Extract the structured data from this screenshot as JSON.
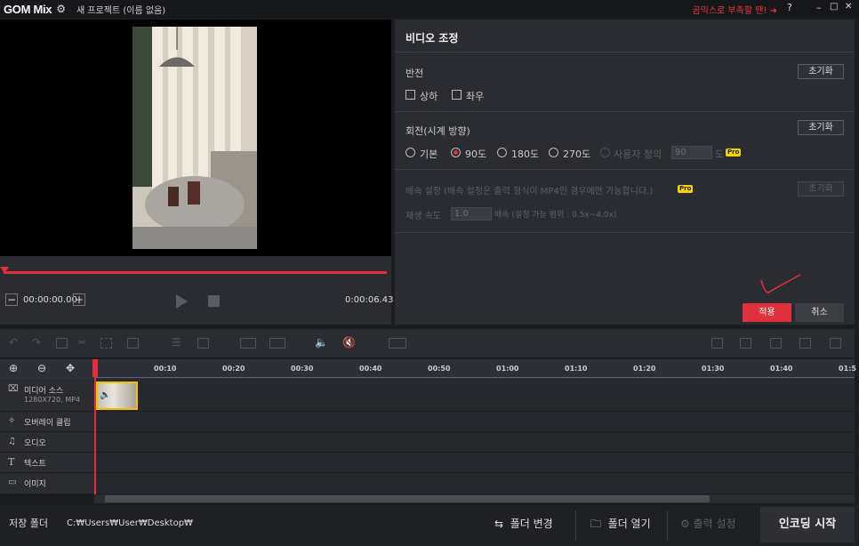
{
  "app": {
    "logo": "GOM Mix",
    "project": "새 프로젝트 (이름 없음)",
    "promo": "곰믹스로 부족할 땐!",
    "help": "?",
    "minimize": "–",
    "maximize": "□",
    "close": "✕",
    "settings_icon": "gear-icon"
  },
  "player": {
    "current_time": "00:00:00.00",
    "total_time": "0:00:06.43",
    "minus": "−",
    "plus": "+"
  },
  "panel": {
    "title": "비디오 조정",
    "flip": {
      "label": "반전",
      "reset": "초기화",
      "options": [
        "상하",
        "좌우"
      ]
    },
    "rotate": {
      "label": "회전(시계 방향)",
      "reset": "초기화",
      "options": [
        "기본",
        "90도",
        "180도",
        "270도",
        "사용자 정의"
      ],
      "selected": "90도",
      "custom_value": "90",
      "unit": "도",
      "pro": "Pro"
    },
    "speed": {
      "label": "배속 설정 (배속 설정은 출력 형식이 MP4인 경우에만 가능합니다.)",
      "reset": "초기화",
      "pro": "Pro",
      "play_speed": "재생 속도",
      "value": "1.0",
      "hint": "배속 (설정 가능 범위 : 0.5x~4.0x)"
    },
    "apply": "적용",
    "cancel": "취소"
  },
  "timeline": {
    "ticks": [
      "00:10",
      "00:20",
      "00:30",
      "00:40",
      "00:50",
      "01:00",
      "01:10",
      "01:20",
      "01:30",
      "01:40",
      "01:5"
    ],
    "tracks": [
      {
        "label": "미디어 소스",
        "sub": "1280X720, MP4",
        "icon": "media-icon"
      },
      {
        "label": "오버레이 클립",
        "icon": "overlay-icon"
      },
      {
        "label": "오디오",
        "icon": "music-icon"
      },
      {
        "label": "텍스트",
        "icon": "text-icon"
      },
      {
        "label": "이미지",
        "icon": "image-icon"
      }
    ]
  },
  "bottom": {
    "save_folder_label": "저장 폴더",
    "path": "C:₩Users₩User₩Desktop₩",
    "change_folder": "폴더 변경",
    "open_folder": "폴더 열기",
    "output_settings": "출력 설정",
    "encode": "인코딩 시작"
  }
}
